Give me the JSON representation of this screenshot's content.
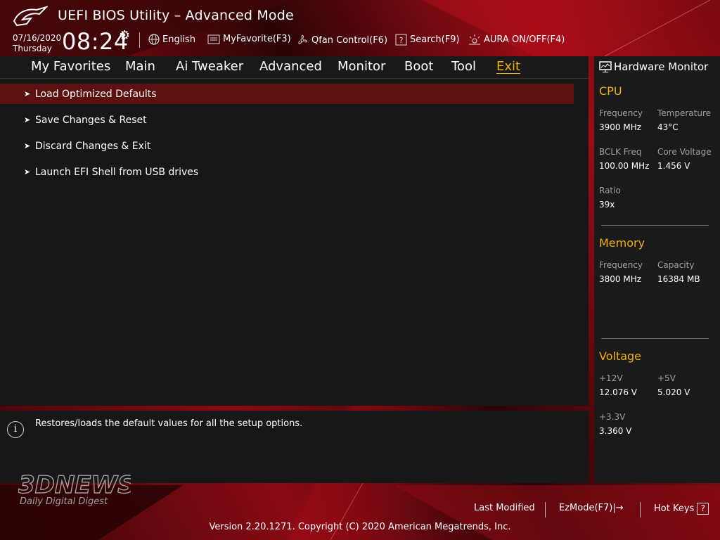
{
  "header": {
    "title": "UEFI BIOS Utility – Advanced Mode",
    "date": "07/16/2020",
    "weekday": "Thursday",
    "time": "08:24",
    "items": [
      {
        "label": "English",
        "icon": "globe-icon"
      },
      {
        "label": "MyFavorite(F3)",
        "icon": "favorites-icon"
      },
      {
        "label": "Qfan Control(F6)",
        "icon": "fan-icon"
      },
      {
        "label": "Search(F9)",
        "icon": "search-help-icon"
      },
      {
        "label": "AURA ON/OFF(F4)",
        "icon": "aura-icon"
      }
    ]
  },
  "menu": {
    "tabs": [
      "My Favorites",
      "Main",
      "Ai Tweaker",
      "Advanced",
      "Monitor",
      "Boot",
      "Tool",
      "Exit"
    ],
    "active": "Exit"
  },
  "exit_items": [
    "Load Optimized Defaults",
    "Save Changes & Reset",
    "Discard Changes & Exit",
    "Launch EFI Shell from USB drives"
  ],
  "help_text": "Restores/loads the default values for all the setup options.",
  "hardware_monitor": {
    "title": "Hardware Monitor",
    "cpu": {
      "heading": "CPU",
      "frequency_label": "Frequency",
      "frequency": "3900 MHz",
      "temperature_label": "Temperature",
      "temperature": "43°C",
      "bclk_label": "BCLK Freq",
      "bclk": "100.00 MHz",
      "core_voltage_label": "Core Voltage",
      "core_voltage": "1.456 V",
      "ratio_label": "Ratio",
      "ratio": "39x"
    },
    "memory": {
      "heading": "Memory",
      "frequency_label": "Frequency",
      "frequency": "3800 MHz",
      "capacity_label": "Capacity",
      "capacity": "16384 MB"
    },
    "voltage": {
      "heading": "Voltage",
      "v12_label": "+12V",
      "v12": "12.076 V",
      "v5_label": "+5V",
      "v5": "5.020 V",
      "v33_label": "+3.3V",
      "v33": "3.360 V"
    }
  },
  "footer": {
    "last_modified": "Last Modified",
    "ezmode": "EzMode(F7)|→",
    "hotkeys": "Hot Keys",
    "hotkeys_key": "?",
    "copyright": "Version 2.20.1271. Copyright (C) 2020 American Megatrends, Inc."
  },
  "watermark": {
    "brand": "3DNEWS",
    "tagline": "Daily Digital Digest"
  },
  "colors": {
    "accent": "#f3b20b",
    "selected_row": "#5c1010",
    "panel": "#171717"
  }
}
